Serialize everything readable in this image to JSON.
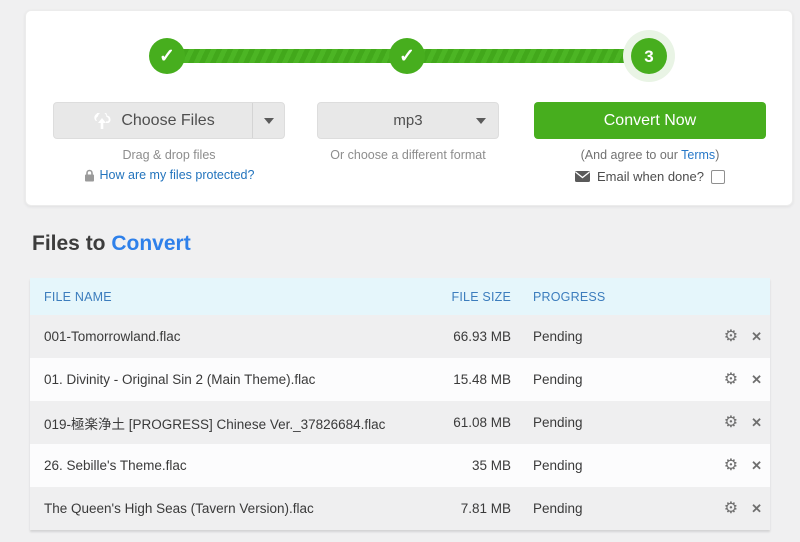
{
  "stepper": {
    "steps": [
      {
        "label": "✓",
        "state": "done"
      },
      {
        "label": "✓",
        "state": "done"
      },
      {
        "label": "3",
        "state": "current"
      }
    ]
  },
  "toolbar": {
    "choose_files_label": "Choose Files",
    "drag_drop_hint": "Drag & drop files",
    "protected_link": "How are my files protected?",
    "format_value": "mp3",
    "format_hint": "Or choose a different format",
    "convert_label": "Convert Now",
    "terms_prefix": "(And agree to our ",
    "terms_link": "Terms",
    "terms_suffix": ")",
    "email_label": "Email when done?"
  },
  "section": {
    "title_prefix": "Files to ",
    "title_accent": "Convert"
  },
  "table": {
    "headers": [
      "FILE NAME",
      "FILE SIZE",
      "PROGRESS"
    ],
    "rows": [
      {
        "name": "001-Tomorrowland.flac",
        "size": "66.93 MB",
        "progress": "Pending"
      },
      {
        "name": "01. Divinity - Original Sin 2 (Main Theme).flac",
        "size": "15.48 MB",
        "progress": "Pending"
      },
      {
        "name": "019-極楽浄土 [PROGRESS] Chinese Ver._37826684.flac",
        "size": "61.08 MB",
        "progress": "Pending"
      },
      {
        "name": "26. Sebille's Theme.flac",
        "size": "35 MB",
        "progress": "Pending"
      },
      {
        "name": "The Queen's High Seas (Tavern Version).flac",
        "size": "7.81 MB",
        "progress": "Pending"
      }
    ]
  },
  "icons": {
    "settings": "⚙",
    "remove": "✕"
  },
  "colors": {
    "accent_green": "#47ae1e",
    "link_blue": "#2778c8",
    "heading_accent_blue": "#2e80ea",
    "table_header_bg": "#e5f6fb",
    "table_header_text": "#3c7dbd",
    "row_alt_gray": "#efeff0"
  }
}
